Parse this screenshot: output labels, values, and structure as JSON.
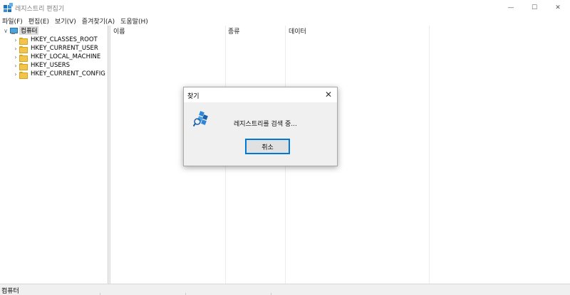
{
  "window": {
    "title": "레지스트리 편집기",
    "min_glyph": "—",
    "max_glyph": "☐",
    "close_glyph": "✕"
  },
  "menu": [
    "파일(F)",
    "편집(E)",
    "보기(V)",
    "즐겨찾기(A)",
    "도움말(H)"
  ],
  "tree": {
    "root_label": "컴퓨터",
    "root_chevron": "∨",
    "child_chevron": "›",
    "children": [
      "HKEY_CLASSES_ROOT",
      "HKEY_CURRENT_USER",
      "HKEY_LOCAL_MACHINE",
      "HKEY_USERS",
      "HKEY_CURRENT_CONFIG"
    ]
  },
  "list": {
    "columns": [
      "이름",
      "종류",
      "데이터"
    ]
  },
  "status": {
    "text": "컴퓨터"
  },
  "dialog": {
    "title": "찾기",
    "close_glyph": "✕",
    "message": "레지스트리를 검색 중...",
    "cancel_label": "취소"
  },
  "colors": {
    "accent": "#0078d7",
    "folder": "#f3c34a"
  },
  "icons": [
    "regedit-app-icon",
    "computer-icon",
    "folder-icon",
    "registry-search-icon",
    "close-icon"
  ]
}
